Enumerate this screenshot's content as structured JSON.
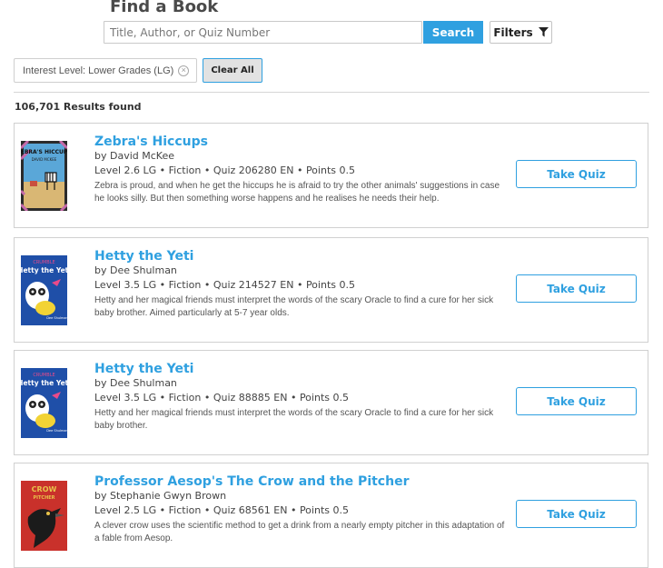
{
  "header": {
    "title": "Find a Book"
  },
  "search": {
    "placeholder": "Title, Author, or Quiz Number",
    "value": "",
    "button_label": "Search",
    "filters_label": "Filters"
  },
  "active_filters": {
    "chip_label": "Interest Level: Lower Grades (LG)",
    "clear_all_label": "Clear All"
  },
  "results": {
    "count_text": "106,701 Results found",
    "take_quiz_label": "Take Quiz",
    "books": [
      {
        "title": "Zebra's Hiccups",
        "author": "by David McKee",
        "meta": "Level 2.6 LG  •  Fiction  •  Quiz 206280 EN  •  Points 0.5",
        "description": "Zebra is proud, and when he get the hiccups he is afraid to try the other animals' suggestions in case he looks silly. But then something worse happens and he realises he needs their help.",
        "cover": {
          "text": "ZEBRA'S HICCUPS",
          "subtext": "DAVID MCKEE",
          "colors": [
            "#5aa7d8",
            "#c56aa9",
            "#2b2b2b"
          ]
        }
      },
      {
        "title": "Hetty the Yeti",
        "author": "by Dee Shulman",
        "meta": "Level 3.5 LG  •  Fiction  •  Quiz 214527 EN  •  Points 0.5",
        "description": "Hetty and her magical friends must interpret the words of the scary Oracle to find a cure for her sick baby brother. Aimed particularly at 5-7 year olds.",
        "cover": {
          "text": "Hetty the Yeti",
          "subtext": "Dee Shulman",
          "colors": [
            "#1f4fa8",
            "#f2d335",
            "#ffffff"
          ]
        }
      },
      {
        "title": "Hetty the Yeti",
        "author": "by Dee Shulman",
        "meta": "Level 3.5 LG  •  Fiction  •  Quiz 88885 EN  •  Points 0.5",
        "description": "Hetty and her magical friends must interpret the words of the scary Oracle to find a cure for her sick baby brother.",
        "cover": {
          "text": "Hetty the Yeti",
          "subtext": "Dee Shulman",
          "colors": [
            "#1f4fa8",
            "#f2d335",
            "#ffffff"
          ]
        }
      },
      {
        "title": "Professor Aesop's The Crow and the Pitcher",
        "author": "by Stephanie Gwyn Brown",
        "meta": "Level 2.5 LG  •  Fiction  •  Quiz 68561 EN  •  Points 0.5",
        "description": "A clever crow uses the scientific method to get a drink from a nearly empty pitcher in this adaptation of a fable from Aesop.",
        "cover": {
          "text": "CROW",
          "subtext": "PITCHER",
          "colors": [
            "#c9312b",
            "#1b1b1b",
            "#e8c24a"
          ]
        }
      }
    ]
  },
  "colors": {
    "accent": "#2fa0e0",
    "divider": "#d6d6d6"
  }
}
